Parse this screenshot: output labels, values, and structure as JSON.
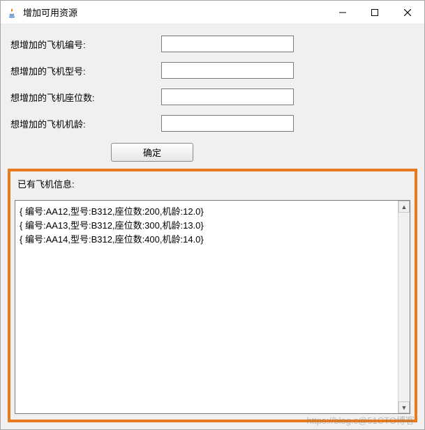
{
  "window": {
    "title": "增加可用资源"
  },
  "form": {
    "labels": {
      "plane_id": "想增加的飞机编号:",
      "plane_model": "想增加的飞机型号:",
      "plane_seats": "想增加的飞机座位数:",
      "plane_age": "想增加的飞机机龄:"
    },
    "values": {
      "plane_id": "",
      "plane_model": "",
      "plane_seats": "",
      "plane_age": ""
    },
    "submit_label": "确定"
  },
  "existing": {
    "section_label": "已有飞机信息:",
    "rows": [
      "{ 编号:AA12,型号:B312,座位数:200,机龄:12.0}",
      "{ 编号:AA13,型号:B312,座位数:300,机龄:13.0}",
      "{ 编号:AA14,型号:B312,座位数:400,机龄:14.0}"
    ]
  },
  "watermark": "https://blog.c@51CTO博客"
}
